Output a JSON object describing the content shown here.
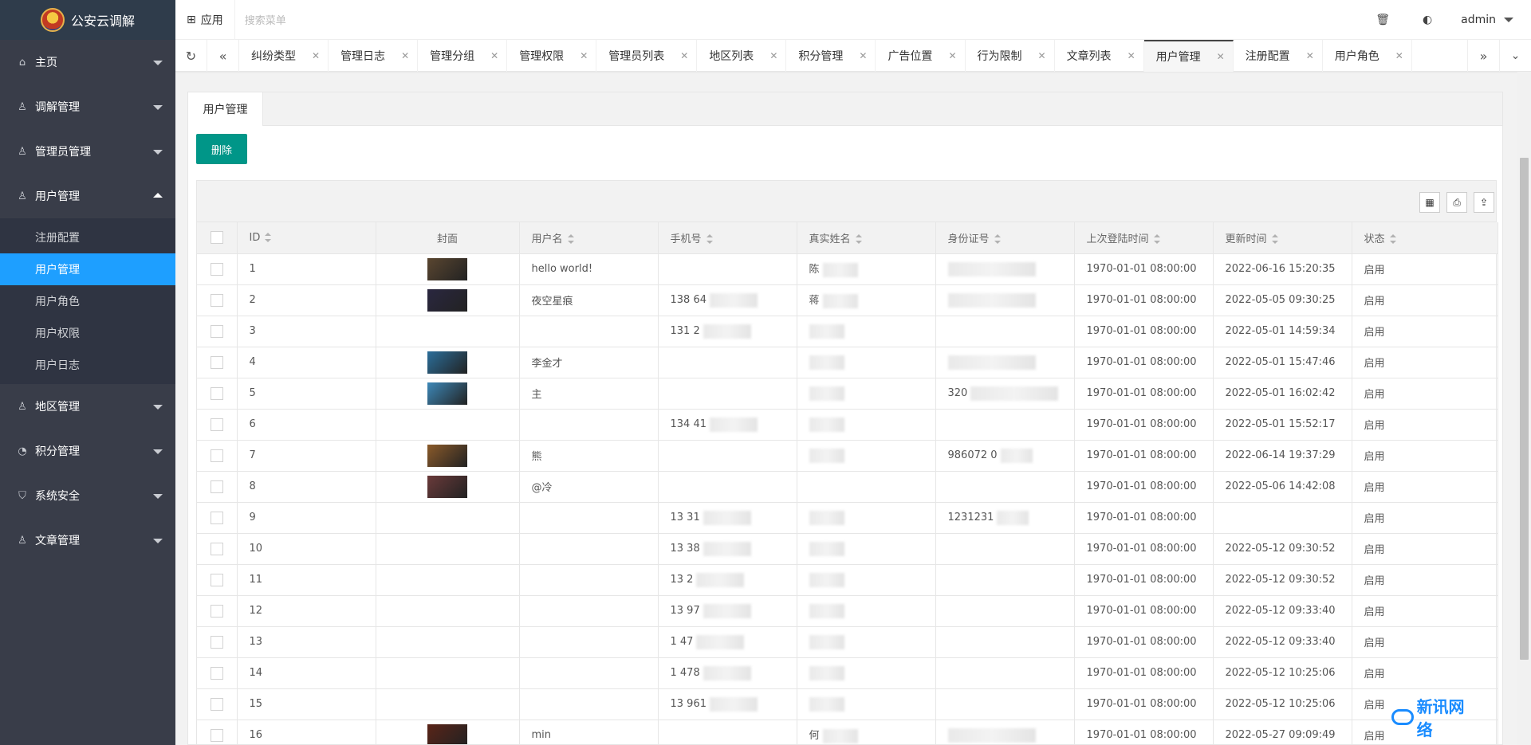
{
  "app": {
    "title": "公安云调解"
  },
  "sidebar": {
    "items": [
      {
        "label": "主页",
        "icon": "home-icon",
        "glyph": "⌂"
      },
      {
        "label": "调解管理",
        "icon": "user-icon",
        "glyph": "♙"
      },
      {
        "label": "管理员管理",
        "icon": "person-icon",
        "glyph": "♙"
      },
      {
        "label": "用户管理",
        "icon": "users-icon",
        "glyph": "♙"
      },
      {
        "label": "地区管理",
        "icon": "users-icon",
        "glyph": "♙"
      },
      {
        "label": "积分管理",
        "icon": "gauge-icon",
        "glyph": "◔"
      },
      {
        "label": "系统安全",
        "icon": "shield-icon",
        "glyph": "⛉"
      },
      {
        "label": "文章管理",
        "icon": "users-icon",
        "glyph": "♙"
      }
    ],
    "submenu": [
      "注册配置",
      "用户管理",
      "用户角色",
      "用户权限",
      "用户日志"
    ],
    "active_sub": "用户管理"
  },
  "header": {
    "app_label": "应用",
    "search_placeholder": "搜索菜单",
    "user": "admin"
  },
  "tabs": [
    "纠纷类型",
    "管理日志",
    "管理分组",
    "管理权限",
    "管理员列表",
    "地区列表",
    "积分管理",
    "广告位置",
    "行为限制",
    "文章列表",
    "用户管理",
    "注册配置",
    "用户角色"
  ],
  "active_tab": "用户管理",
  "content": {
    "tab_label": "用户管理",
    "delete_label": "删除"
  },
  "table": {
    "columns": [
      "ID",
      "封面",
      "用户名",
      "手机号",
      "真实姓名",
      "身份证号",
      "上次登陆时间",
      "更新时间",
      "状态"
    ],
    "rows": [
      {
        "id": "1",
        "cover": "#5a4630",
        "username": "hello world!",
        "phone": "",
        "phone_blur": 0,
        "name": "陈",
        "name_blur": 1,
        "idcard": "",
        "idcard_blur": 2,
        "last_login": "1970-01-01 08:00:00",
        "updated": "2022-06-16 15:20:35",
        "status": "启用"
      },
      {
        "id": "2",
        "cover": "#2a2740",
        "username": "夜空星痕",
        "phone": "138 64",
        "phone_blur": 1,
        "name": "蒋",
        "name_blur": 1,
        "idcard": "",
        "idcard_blur": 2,
        "last_login": "1970-01-01 08:00:00",
        "updated": "2022-05-05 09:30:25",
        "status": "启用"
      },
      {
        "id": "3",
        "cover": "",
        "username": "",
        "phone": "131 2",
        "phone_blur": 1,
        "name": "",
        "name_blur": 1,
        "idcard": "",
        "idcard_blur": 0,
        "last_login": "1970-01-01 08:00:00",
        "updated": "2022-05-01 14:59:34",
        "status": "启用"
      },
      {
        "id": "4",
        "cover": "#2b6e9a",
        "username": "李金才",
        "phone": "",
        "phone_blur": 0,
        "name": "",
        "name_blur": 1,
        "idcard": "",
        "idcard_blur": 2,
        "last_login": "1970-01-01 08:00:00",
        "updated": "2022-05-01 15:47:46",
        "status": "启用"
      },
      {
        "id": "5",
        "cover": "#3d88b8",
        "username": "主",
        "phone": "",
        "phone_blur": 0,
        "name": "",
        "name_blur": 1,
        "idcard": "320",
        "idcard_blur": 2,
        "last_login": "1970-01-01 08:00:00",
        "updated": "2022-05-01 16:02:42",
        "status": "启用"
      },
      {
        "id": "6",
        "cover": "",
        "username": "",
        "phone": "134 41",
        "phone_blur": 1,
        "name": "",
        "name_blur": 1,
        "idcard": "",
        "idcard_blur": 0,
        "last_login": "1970-01-01 08:00:00",
        "updated": "2022-05-01 15:52:17",
        "status": "启用"
      },
      {
        "id": "7",
        "cover": "#8a5a2a",
        "username": "熊",
        "phone": "",
        "phone_blur": 0,
        "name": "",
        "name_blur": 1,
        "idcard": "986072 0",
        "idcard_blur": 1,
        "last_login": "1970-01-01 08:00:00",
        "updated": "2022-06-14 19:37:29",
        "status": "启用"
      },
      {
        "id": "8",
        "cover": "#6a3a3a",
        "username": "@冷",
        "phone": "",
        "phone_blur": 0,
        "name": "",
        "name_blur": 0,
        "idcard": "",
        "idcard_blur": 0,
        "last_login": "1970-01-01 08:00:00",
        "updated": "2022-05-06 14:42:08",
        "status": "启用"
      },
      {
        "id": "9",
        "cover": "",
        "username": "",
        "phone": "13 31",
        "phone_blur": 1,
        "name": "",
        "name_blur": 1,
        "idcard": "1231231",
        "idcard_blur": 1,
        "last_login": "1970-01-01 08:00:00",
        "updated": "",
        "status": "启用"
      },
      {
        "id": "10",
        "cover": "",
        "username": "",
        "phone": "13 38",
        "phone_blur": 1,
        "name": "",
        "name_blur": 1,
        "idcard": "",
        "idcard_blur": 0,
        "last_login": "1970-01-01 08:00:00",
        "updated": "2022-05-12 09:30:52",
        "status": "启用"
      },
      {
        "id": "11",
        "cover": "",
        "username": "",
        "phone": "13 2",
        "phone_blur": 1,
        "name": "",
        "name_blur": 1,
        "idcard": "",
        "idcard_blur": 0,
        "last_login": "1970-01-01 08:00:00",
        "updated": "2022-05-12 09:30:52",
        "status": "启用"
      },
      {
        "id": "12",
        "cover": "",
        "username": "",
        "phone": "13 97",
        "phone_blur": 1,
        "name": "",
        "name_blur": 1,
        "idcard": "",
        "idcard_blur": 0,
        "last_login": "1970-01-01 08:00:00",
        "updated": "2022-05-12 09:33:40",
        "status": "启用"
      },
      {
        "id": "13",
        "cover": "",
        "username": "",
        "phone": "1 47",
        "phone_blur": 1,
        "name": "",
        "name_blur": 1,
        "idcard": "",
        "idcard_blur": 0,
        "last_login": "1970-01-01 08:00:00",
        "updated": "2022-05-12 09:33:40",
        "status": "启用"
      },
      {
        "id": "14",
        "cover": "",
        "username": "",
        "phone": "1 478",
        "phone_blur": 1,
        "name": "",
        "name_blur": 1,
        "idcard": "",
        "idcard_blur": 0,
        "last_login": "1970-01-01 08:00:00",
        "updated": "2022-05-12 10:25:06",
        "status": "启用"
      },
      {
        "id": "15",
        "cover": "",
        "username": "",
        "phone": "13 961",
        "phone_blur": 1,
        "name": "",
        "name_blur": 1,
        "idcard": "",
        "idcard_blur": 0,
        "last_login": "1970-01-01 08:00:00",
        "updated": "2022-05-12 10:25:06",
        "status": "启用"
      },
      {
        "id": "16",
        "cover": "#5a2418",
        "username": "min",
        "phone": "",
        "phone_blur": 0,
        "name": "何",
        "name_blur": 1,
        "idcard": "",
        "idcard_blur": 2,
        "last_login": "1970-01-01 08:00:00",
        "updated": "2022-05-27 09:09:49",
        "status": "启用"
      }
    ]
  },
  "watermark": "新讯网络",
  "colors": {
    "sidebar_bg": "#393d49",
    "active": "#1e9fff",
    "delete_btn": "#009688"
  }
}
